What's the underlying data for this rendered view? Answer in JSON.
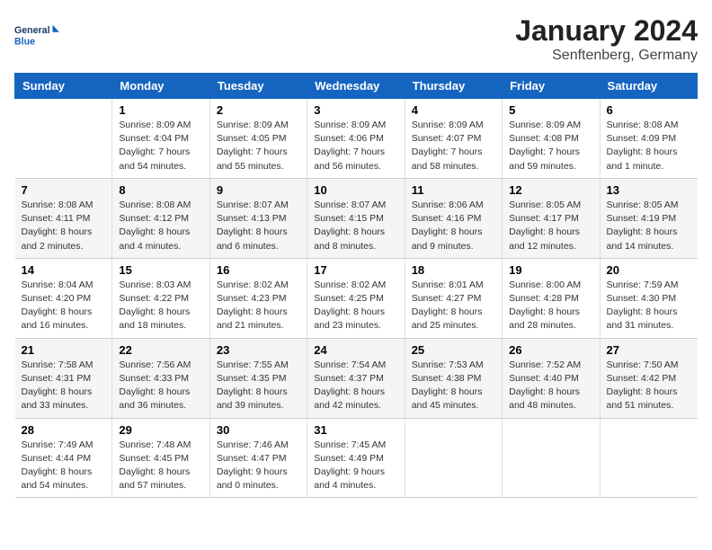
{
  "logo": {
    "line1": "General",
    "line2": "Blue"
  },
  "title": "January 2024",
  "subtitle": "Senftenberg, Germany",
  "days_header": [
    "Sunday",
    "Monday",
    "Tuesday",
    "Wednesday",
    "Thursday",
    "Friday",
    "Saturday"
  ],
  "weeks": [
    [
      {
        "day": "",
        "info": ""
      },
      {
        "day": "1",
        "info": "Sunrise: 8:09 AM\nSunset: 4:04 PM\nDaylight: 7 hours\nand 54 minutes."
      },
      {
        "day": "2",
        "info": "Sunrise: 8:09 AM\nSunset: 4:05 PM\nDaylight: 7 hours\nand 55 minutes."
      },
      {
        "day": "3",
        "info": "Sunrise: 8:09 AM\nSunset: 4:06 PM\nDaylight: 7 hours\nand 56 minutes."
      },
      {
        "day": "4",
        "info": "Sunrise: 8:09 AM\nSunset: 4:07 PM\nDaylight: 7 hours\nand 58 minutes."
      },
      {
        "day": "5",
        "info": "Sunrise: 8:09 AM\nSunset: 4:08 PM\nDaylight: 7 hours\nand 59 minutes."
      },
      {
        "day": "6",
        "info": "Sunrise: 8:08 AM\nSunset: 4:09 PM\nDaylight: 8 hours\nand 1 minute."
      }
    ],
    [
      {
        "day": "7",
        "info": "Sunrise: 8:08 AM\nSunset: 4:11 PM\nDaylight: 8 hours\nand 2 minutes."
      },
      {
        "day": "8",
        "info": "Sunrise: 8:08 AM\nSunset: 4:12 PM\nDaylight: 8 hours\nand 4 minutes."
      },
      {
        "day": "9",
        "info": "Sunrise: 8:07 AM\nSunset: 4:13 PM\nDaylight: 8 hours\nand 6 minutes."
      },
      {
        "day": "10",
        "info": "Sunrise: 8:07 AM\nSunset: 4:15 PM\nDaylight: 8 hours\nand 8 minutes."
      },
      {
        "day": "11",
        "info": "Sunrise: 8:06 AM\nSunset: 4:16 PM\nDaylight: 8 hours\nand 9 minutes."
      },
      {
        "day": "12",
        "info": "Sunrise: 8:05 AM\nSunset: 4:17 PM\nDaylight: 8 hours\nand 12 minutes."
      },
      {
        "day": "13",
        "info": "Sunrise: 8:05 AM\nSunset: 4:19 PM\nDaylight: 8 hours\nand 14 minutes."
      }
    ],
    [
      {
        "day": "14",
        "info": "Sunrise: 8:04 AM\nSunset: 4:20 PM\nDaylight: 8 hours\nand 16 minutes."
      },
      {
        "day": "15",
        "info": "Sunrise: 8:03 AM\nSunset: 4:22 PM\nDaylight: 8 hours\nand 18 minutes."
      },
      {
        "day": "16",
        "info": "Sunrise: 8:02 AM\nSunset: 4:23 PM\nDaylight: 8 hours\nand 21 minutes."
      },
      {
        "day": "17",
        "info": "Sunrise: 8:02 AM\nSunset: 4:25 PM\nDaylight: 8 hours\nand 23 minutes."
      },
      {
        "day": "18",
        "info": "Sunrise: 8:01 AM\nSunset: 4:27 PM\nDaylight: 8 hours\nand 25 minutes."
      },
      {
        "day": "19",
        "info": "Sunrise: 8:00 AM\nSunset: 4:28 PM\nDaylight: 8 hours\nand 28 minutes."
      },
      {
        "day": "20",
        "info": "Sunrise: 7:59 AM\nSunset: 4:30 PM\nDaylight: 8 hours\nand 31 minutes."
      }
    ],
    [
      {
        "day": "21",
        "info": "Sunrise: 7:58 AM\nSunset: 4:31 PM\nDaylight: 8 hours\nand 33 minutes."
      },
      {
        "day": "22",
        "info": "Sunrise: 7:56 AM\nSunset: 4:33 PM\nDaylight: 8 hours\nand 36 minutes."
      },
      {
        "day": "23",
        "info": "Sunrise: 7:55 AM\nSunset: 4:35 PM\nDaylight: 8 hours\nand 39 minutes."
      },
      {
        "day": "24",
        "info": "Sunrise: 7:54 AM\nSunset: 4:37 PM\nDaylight: 8 hours\nand 42 minutes."
      },
      {
        "day": "25",
        "info": "Sunrise: 7:53 AM\nSunset: 4:38 PM\nDaylight: 8 hours\nand 45 minutes."
      },
      {
        "day": "26",
        "info": "Sunrise: 7:52 AM\nSunset: 4:40 PM\nDaylight: 8 hours\nand 48 minutes."
      },
      {
        "day": "27",
        "info": "Sunrise: 7:50 AM\nSunset: 4:42 PM\nDaylight: 8 hours\nand 51 minutes."
      }
    ],
    [
      {
        "day": "28",
        "info": "Sunrise: 7:49 AM\nSunset: 4:44 PM\nDaylight: 8 hours\nand 54 minutes."
      },
      {
        "day": "29",
        "info": "Sunrise: 7:48 AM\nSunset: 4:45 PM\nDaylight: 8 hours\nand 57 minutes."
      },
      {
        "day": "30",
        "info": "Sunrise: 7:46 AM\nSunset: 4:47 PM\nDaylight: 9 hours\nand 0 minutes."
      },
      {
        "day": "31",
        "info": "Sunrise: 7:45 AM\nSunset: 4:49 PM\nDaylight: 9 hours\nand 4 minutes."
      },
      {
        "day": "",
        "info": ""
      },
      {
        "day": "",
        "info": ""
      },
      {
        "day": "",
        "info": ""
      }
    ]
  ]
}
